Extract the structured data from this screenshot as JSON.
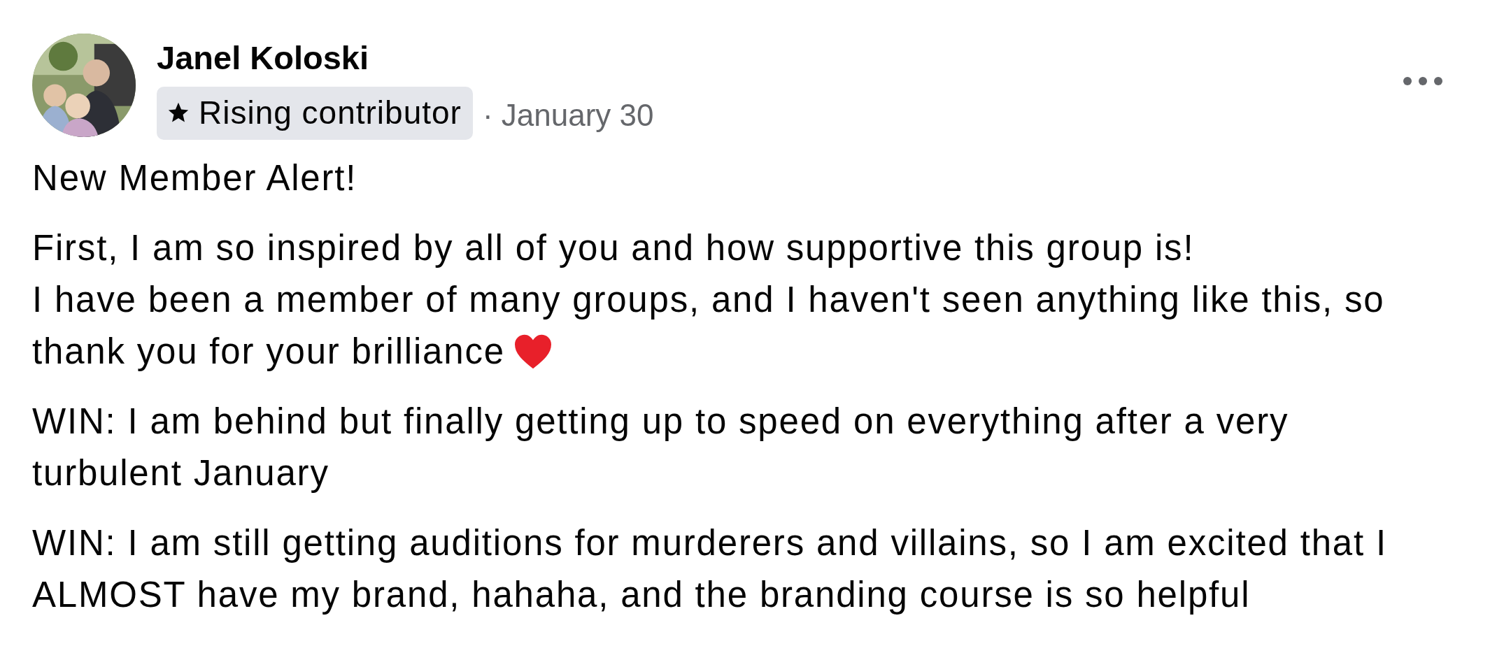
{
  "post": {
    "author": "Janel Koloski",
    "badge": {
      "label": "Rising contributor"
    },
    "date": "· January 30",
    "paragraphs": [
      {
        "lines": [
          "New Member Alert!"
        ],
        "heart": false
      },
      {
        "lines": [
          "First, I am so inspired by all of you and how supportive this group is!",
          "I have been a member of many groups, and I haven't seen anything like this, so",
          "thank you for your brilliance"
        ],
        "heart": true
      },
      {
        "lines": [
          "WIN: I am behind but finally getting up to speed on everything after a very",
          "turbulent January"
        ],
        "heart": false
      },
      {
        "lines": [
          "WIN:  I am still getting auditions for murderers and villains, so I am excited that I",
          "ALMOST have my brand, hahaha, and the branding course is so helpful"
        ],
        "heart": false
      }
    ]
  }
}
